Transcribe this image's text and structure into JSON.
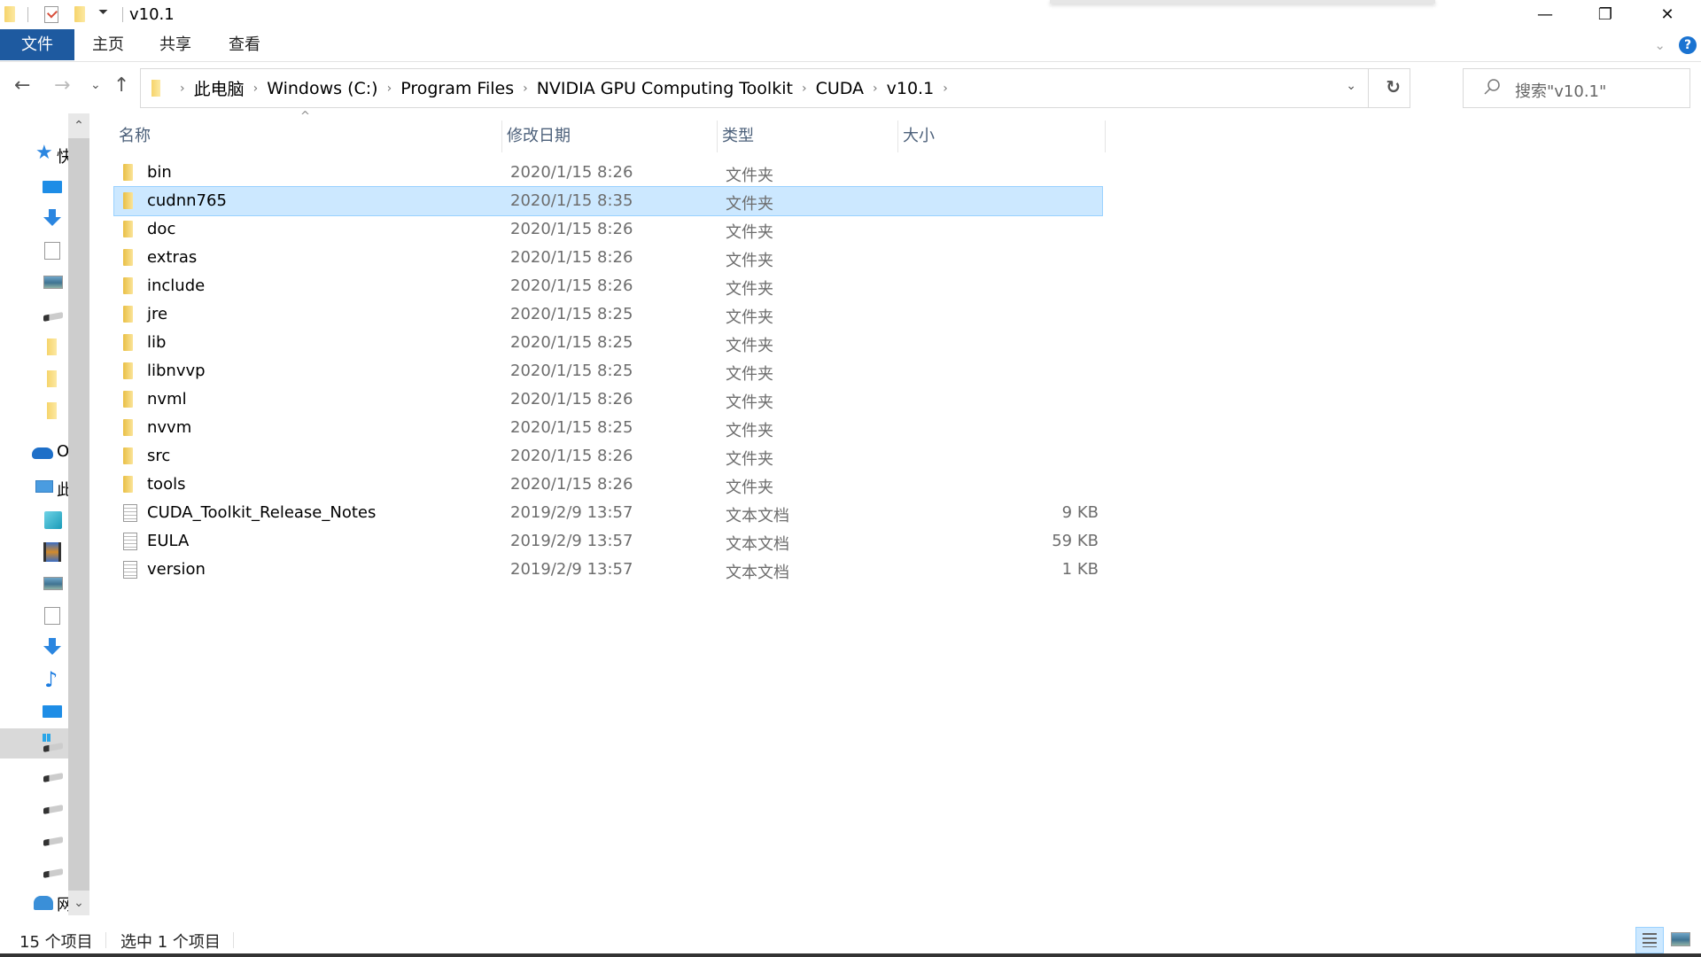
{
  "window": {
    "title": "v10.1",
    "controls": {
      "minimize": "—",
      "restore": "❐",
      "close": "✕"
    }
  },
  "ribbon": {
    "tabs": [
      {
        "label": "文件",
        "active": true
      },
      {
        "label": "主页"
      },
      {
        "label": "共享"
      },
      {
        "label": "查看"
      }
    ],
    "expand_icon": "⌄",
    "help_icon": "?",
    "accent_color": "#1e5aa0"
  },
  "nav": {
    "back": "←",
    "forward": "→",
    "recent": "⌄",
    "up": "↑"
  },
  "address": {
    "crumbs": [
      "此电脑",
      "Windows (C:)",
      "Program Files",
      "NVIDIA GPU Computing Toolkit",
      "CUDA",
      "v10.1"
    ],
    "separator": "›",
    "dropdown": "⌄",
    "refresh": "↻"
  },
  "search": {
    "placeholder": "搜索\"v10.1\""
  },
  "navpane": {
    "items": [
      {
        "icon": "quick-access-icon",
        "label": "快速访问"
      },
      {
        "icon": "desktop-icon",
        "label": ""
      },
      {
        "icon": "downloads-icon",
        "label": ""
      },
      {
        "icon": "documents-icon",
        "label": ""
      },
      {
        "icon": "pictures-icon",
        "label": ""
      },
      {
        "icon": "drive-icon",
        "label": ""
      },
      {
        "icon": "folder-icon",
        "label": ""
      },
      {
        "icon": "folder-icon",
        "label": ""
      },
      {
        "icon": "folder-icon",
        "label": ""
      },
      {
        "icon": "onedrive-icon",
        "label": "OneDrive"
      },
      {
        "icon": "this-pc-icon",
        "label": "此电脑"
      },
      {
        "icon": "3d-objects-icon",
        "label": ""
      },
      {
        "icon": "videos-icon",
        "label": ""
      },
      {
        "icon": "pictures-icon",
        "label": ""
      },
      {
        "icon": "documents-icon",
        "label": ""
      },
      {
        "icon": "downloads-icon",
        "label": ""
      },
      {
        "icon": "music-icon",
        "label": ""
      },
      {
        "icon": "desktop-icon",
        "label": ""
      },
      {
        "icon": "windows-drive-icon",
        "label": "",
        "selected": true
      },
      {
        "icon": "drive-icon",
        "label": ""
      },
      {
        "icon": "drive-icon",
        "label": ""
      },
      {
        "icon": "drive-icon",
        "label": ""
      },
      {
        "icon": "drive-icon",
        "label": ""
      },
      {
        "icon": "network-icon",
        "label": "网络"
      }
    ]
  },
  "list": {
    "sort_indicator": "^",
    "columns": [
      "名称",
      "修改日期",
      "类型",
      "大小"
    ],
    "rows": [
      {
        "name": "bin",
        "date": "2020/1/15 8:26",
        "type": "文件夹",
        "size": "",
        "kind": "folder"
      },
      {
        "name": "cudnn765",
        "date": "2020/1/15 8:35",
        "type": "文件夹",
        "size": "",
        "kind": "folder",
        "selected": true
      },
      {
        "name": "doc",
        "date": "2020/1/15 8:26",
        "type": "文件夹",
        "size": "",
        "kind": "folder"
      },
      {
        "name": "extras",
        "date": "2020/1/15 8:26",
        "type": "文件夹",
        "size": "",
        "kind": "folder"
      },
      {
        "name": "include",
        "date": "2020/1/15 8:26",
        "type": "文件夹",
        "size": "",
        "kind": "folder"
      },
      {
        "name": "jre",
        "date": "2020/1/15 8:25",
        "type": "文件夹",
        "size": "",
        "kind": "folder"
      },
      {
        "name": "lib",
        "date": "2020/1/15 8:25",
        "type": "文件夹",
        "size": "",
        "kind": "folder"
      },
      {
        "name": "libnvvp",
        "date": "2020/1/15 8:25",
        "type": "文件夹",
        "size": "",
        "kind": "folder"
      },
      {
        "name": "nvml",
        "date": "2020/1/15 8:26",
        "type": "文件夹",
        "size": "",
        "kind": "folder"
      },
      {
        "name": "nvvm",
        "date": "2020/1/15 8:25",
        "type": "文件夹",
        "size": "",
        "kind": "folder"
      },
      {
        "name": "src",
        "date": "2020/1/15 8:26",
        "type": "文件夹",
        "size": "",
        "kind": "folder"
      },
      {
        "name": "tools",
        "date": "2020/1/15 8:26",
        "type": "文件夹",
        "size": "",
        "kind": "folder"
      },
      {
        "name": "CUDA_Toolkit_Release_Notes",
        "date": "2019/2/9 13:57",
        "type": "文本文档",
        "size": "9 KB",
        "kind": "text"
      },
      {
        "name": "EULA",
        "date": "2019/2/9 13:57",
        "type": "文本文档",
        "size": "59 KB",
        "kind": "text"
      },
      {
        "name": "version",
        "date": "2019/2/9 13:57",
        "type": "文本文档",
        "size": "1 KB",
        "kind": "text"
      }
    ]
  },
  "status": {
    "item_count": "15 个项目",
    "selected": "选中 1 个项目"
  },
  "colors": {
    "selection_bg": "#cce8ff",
    "selection_border": "#99d1ff",
    "header_text": "#4c607a"
  }
}
